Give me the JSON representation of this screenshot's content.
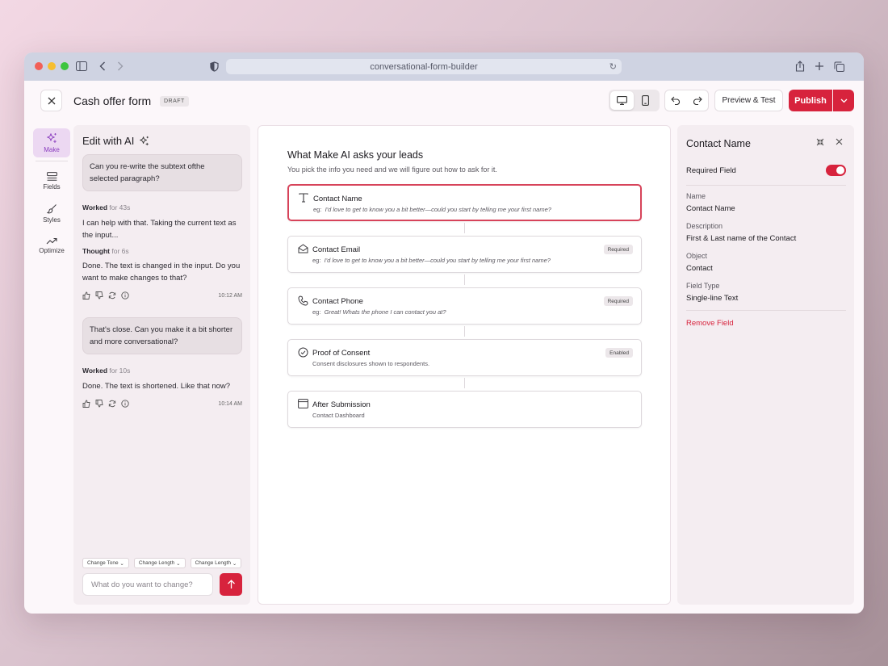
{
  "browser": {
    "url": "conversational-form-builder"
  },
  "header": {
    "title": "Cash offer form",
    "status_badge": "DRAFT",
    "preview_label": "Preview & Test",
    "publish_label": "Publish"
  },
  "nav": {
    "items": [
      {
        "label": "Make",
        "icon": "sparkle-icon",
        "active": true
      },
      {
        "label": "Fields",
        "icon": "fields-icon"
      },
      {
        "label": "Styles",
        "icon": "brush-icon"
      },
      {
        "label": "Optimize",
        "icon": "trend-icon"
      }
    ]
  },
  "chat": {
    "title": "Edit with AI",
    "messages": [
      {
        "user": "Can you re-write the subtext ofthe selected paragraph?"
      },
      {
        "meta_strong": "Worked",
        "meta_dim": "for 43s",
        "text": "I can help with that. Taking the current text as the input..."
      },
      {
        "meta_strong": "Thought",
        "meta_dim": "for 6s",
        "text": "Done. The text is changed in the input. Do you want to make changes to that?",
        "time": "10:12 AM"
      },
      {
        "user": "That's close. Can you make it a bit shorter and more conversational?"
      },
      {
        "meta_strong": "Worked",
        "meta_dim": "for 10s",
        "text": "Done. The text is shortened. Like that now?",
        "time": "10:14 AM"
      }
    ],
    "chips": [
      "Change Tone",
      "Change Length",
      "Change Length"
    ],
    "input_placeholder": "What do you want to change?"
  },
  "canvas": {
    "title": "What Make AI asks your leads",
    "subtitle": "You pick the info you need and we will figure out how to ask for it.",
    "fields": [
      {
        "name": "Contact Name",
        "desc_prefix": "eg:",
        "desc": "I'd love to get to know you a bit better—could you start by telling me your first name?",
        "badge": "",
        "icon": "text-icon",
        "selected": true
      },
      {
        "name": "Contact Email",
        "desc_prefix": "eg:",
        "desc": "I'd love to get to know you a bit better—could you start by telling me your first name?",
        "badge": "Required",
        "icon": "mail-icon"
      },
      {
        "name": "Contact Phone",
        "desc_prefix": "eg:",
        "desc": "Great! Whats the phone I can contact you at?",
        "badge": "Required",
        "icon": "phone-icon"
      },
      {
        "name": "Proof of Consent",
        "desc_prefix": "",
        "desc": "Consent disclosures shown to respondents.",
        "badge": "Enabled",
        "icon": "check-circle-icon"
      },
      {
        "name": "After Submission",
        "desc_prefix": "",
        "desc": "Contact Dashboard",
        "badge": "",
        "icon": "window-icon"
      }
    ]
  },
  "properties": {
    "title": "Contact Name",
    "required_label": "Required Field",
    "required": true,
    "name_label": "Name",
    "name_value": "Contact Name",
    "description_label": "Description",
    "description_value": "First & Last name of the Contact",
    "object_label": "Object",
    "object_value": "Contact",
    "type_label": "Field Type",
    "type_value": "Single-line Text",
    "remove_label": "Remove Field"
  },
  "colors": {
    "accent": "#d7233d",
    "make_active": "#8a3dbf"
  }
}
